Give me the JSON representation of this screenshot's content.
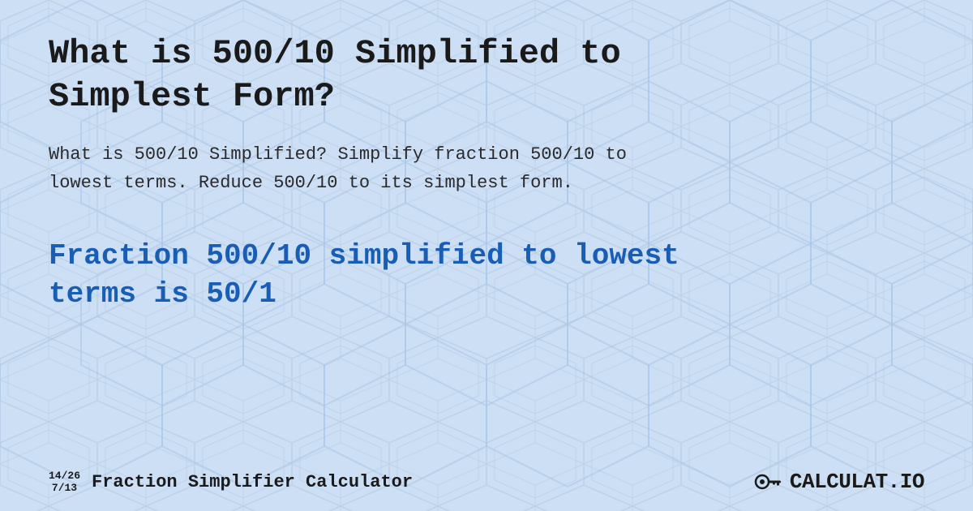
{
  "page": {
    "background_color": "#c8ddf5",
    "pattern_color_light": "#d8e8f8",
    "pattern_color_dark": "#b8cce8"
  },
  "main_title": "What is 500/10 Simplified to Simplest Form?",
  "description": "What is 500/10 Simplified? Simplify fraction 500/10 to lowest terms. Reduce 500/10 to its simplest form.",
  "result": {
    "text": "Fraction 500/10 simplified to lowest terms is 50/1"
  },
  "footer": {
    "fraction1_top": "14/26",
    "fraction1_bottom": "7/13",
    "brand_text": "Fraction Simplifier Calculator",
    "logo_text": "CALCULAT.IO"
  }
}
